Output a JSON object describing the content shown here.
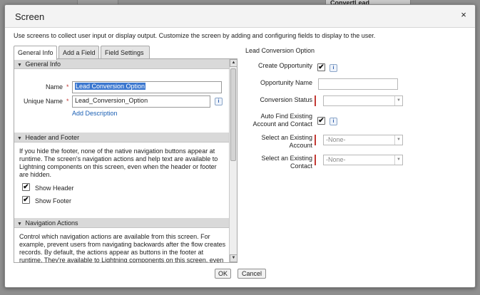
{
  "background": {
    "node_label": "ConvertLead"
  },
  "modal": {
    "title": "Screen",
    "close_glyph": "×",
    "intro": "Use screens to collect user input or display output. Customize the screen by adding and configuring fields to display to the user."
  },
  "tabs": [
    {
      "label": "General Info",
      "active": true
    },
    {
      "label": "Add a Field",
      "active": false
    },
    {
      "label": "Field Settings",
      "active": false
    }
  ],
  "general_info": {
    "heading": "General Info",
    "name_label": "Name",
    "name_value": "Lead Conversion Option",
    "unique_name_label": "Unique Name",
    "unique_name_value": "Lead_Conversion_Option",
    "add_description": "Add Description"
  },
  "header_footer": {
    "heading": "Header and Footer",
    "description": "If you hide the footer, none of the native navigation buttons appear at runtime. The screen's navigation actions and help text are available to Lightning components on this screen, even when the header or footer are hidden.",
    "show_header_label": "Show Header",
    "show_header_checked": true,
    "show_footer_label": "Show Footer",
    "show_footer_checked": true
  },
  "navigation_actions": {
    "heading": "Navigation Actions",
    "description": "Control which navigation actions are available from this screen. For example, prevent users from navigating backwards after the flow creates records. By default, the actions appear as buttons in the footer at runtime. They're available to Lightning components on this screen, even when the footer is hidden."
  },
  "preview": {
    "title": "Lead Conversion Option",
    "create_opportunity_label": "Create Opportunity",
    "create_opportunity_checked": true,
    "opportunity_name_label": "Opportunity Name",
    "conversion_status_label": "Conversion Status",
    "auto_find_label_1": "Auto Find Existing",
    "auto_find_label_2": "Account and Contact",
    "auto_find_checked": true,
    "select_account_label_1": "Select an Existing",
    "select_account_label_2": "Account",
    "select_account_value": "-None-",
    "select_contact_label_1": "Select an Existing",
    "select_contact_label_2": "Contact",
    "select_contact_value": "-None-"
  },
  "icons": {
    "info": "i",
    "checkmark": "✔",
    "triangle_down": "▼",
    "arrow_up": "▲",
    "arrow_down": "▼"
  },
  "footer": {
    "ok_label": "OK",
    "cancel_label": "Cancel"
  },
  "colors": {
    "required": "#c23934",
    "link": "#1a5fb4",
    "selection": "#3b77cf"
  }
}
